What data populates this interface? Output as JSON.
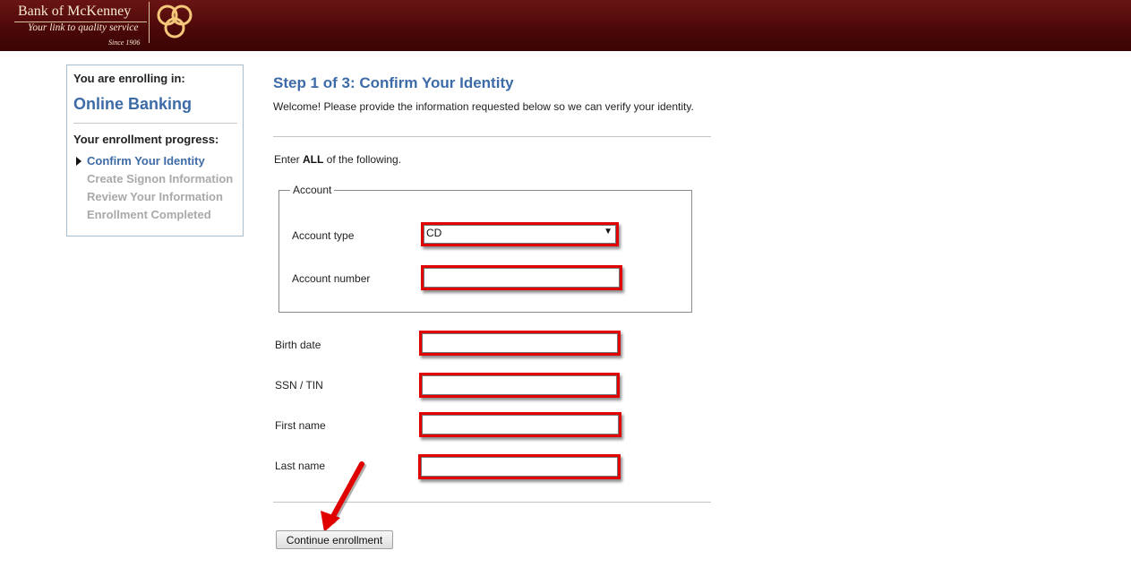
{
  "header": {
    "bank_name": "Bank of McKenney",
    "tagline": "Your link to quality service",
    "since": "Since 1906",
    "logo_icon": "three-rings-logo",
    "colors": {
      "bar": "#4a0808",
      "ring": "#f5c77a"
    }
  },
  "sidebar": {
    "enrolling_label": "You are enrolling in:",
    "product": "Online Banking",
    "progress_label": "Your enrollment progress:",
    "steps": [
      {
        "label": "Confirm Your Identity",
        "current": true
      },
      {
        "label": "Create Signon Information",
        "current": false
      },
      {
        "label": "Review Your Information",
        "current": false
      },
      {
        "label": "Enrollment Completed",
        "current": false
      }
    ]
  },
  "main": {
    "title": "Step 1 of 3: Confirm Your Identity",
    "welcome": "Welcome! Please provide the information requested below so we can verify your identity.",
    "instruction_prefix": "Enter ",
    "instruction_bold": "ALL",
    "instruction_suffix": " of the following.",
    "account_legend": "Account",
    "fields": {
      "account_type": {
        "label": "Account type",
        "value": "CD"
      },
      "account_number": {
        "label": "Account number",
        "value": ""
      },
      "birth_date": {
        "label": "Birth date",
        "value": ""
      },
      "ssn_tin": {
        "label": "SSN / TIN",
        "value": ""
      },
      "first_name": {
        "label": "First name",
        "value": ""
      },
      "last_name": {
        "label": "Last name",
        "value": ""
      }
    },
    "continue_button": "Continue enrollment",
    "highlight_color": "#e00000"
  }
}
